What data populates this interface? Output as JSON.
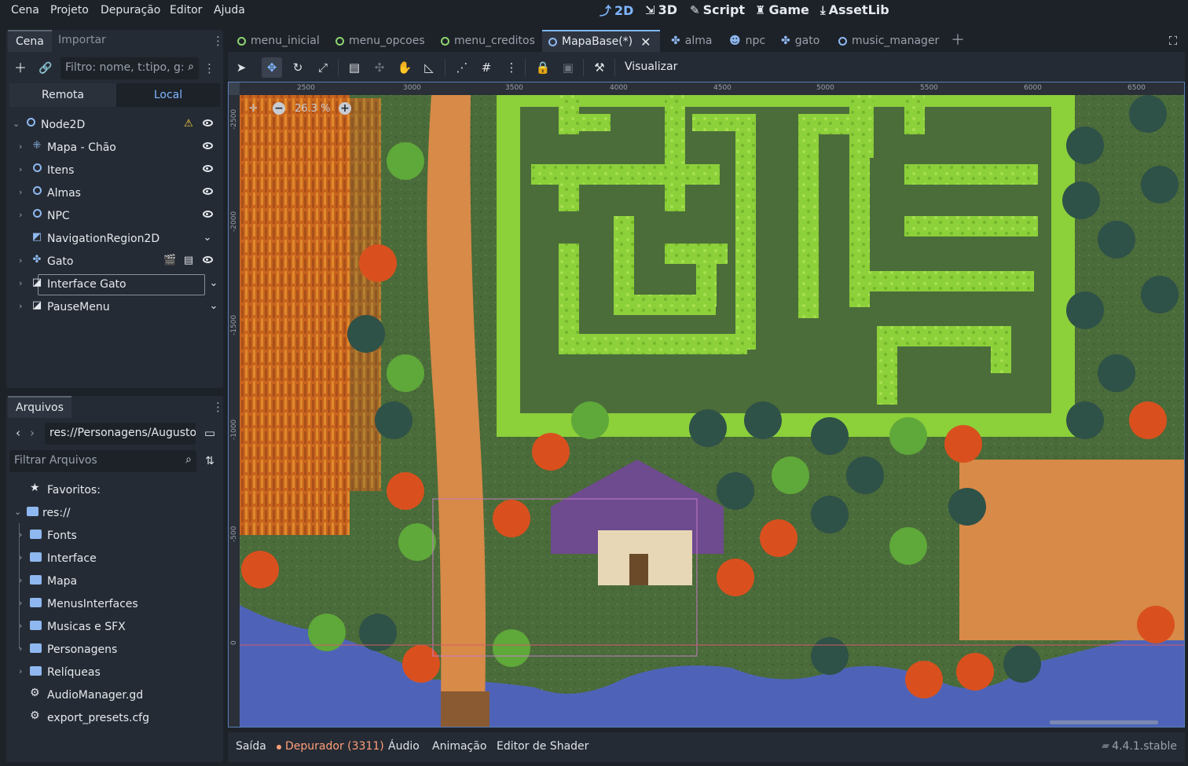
{
  "menu": [
    "Cena",
    "Projeto",
    "Depuração",
    "Editor",
    "Ajuda"
  ],
  "workspaces": [
    {
      "label": "2D",
      "icon": "2d-icon",
      "active": true
    },
    {
      "label": "3D",
      "icon": "3d-icon",
      "active": false
    },
    {
      "label": "Script",
      "icon": "script-icon",
      "active": false
    },
    {
      "label": "Game",
      "icon": "game-icon",
      "active": false
    },
    {
      "label": "AssetLib",
      "icon": "assetlib-icon",
      "active": false
    }
  ],
  "scene_dock": {
    "tabs": [
      "Cena",
      "Importar"
    ],
    "filter_placeholder": "Filtro: nome, t:tipo, g:",
    "remote_label": "Remota",
    "local_label": "Local",
    "nodes": [
      {
        "name": "Node2D",
        "icon": "node2d-icon"
      },
      {
        "name": "Mapa - Chão",
        "icon": "tilemap-icon"
      },
      {
        "name": "Itens",
        "icon": "node2d-icon"
      },
      {
        "name": "Almas",
        "icon": "node2d-icon"
      },
      {
        "name": "NPC",
        "icon": "node2d-icon"
      },
      {
        "name": "NavigationRegion2D",
        "icon": "navigation-icon"
      },
      {
        "name": "Gato",
        "icon": "character-icon"
      },
      {
        "name": "Interface Gato",
        "icon": "canvaslayer-icon"
      },
      {
        "name": "PauseMenu",
        "icon": "canvaslayer-icon"
      }
    ]
  },
  "file_dock": {
    "title": "Arquivos",
    "path": "res://Personagens/Augusto",
    "filter_placeholder": "Filtrar Arquivos",
    "favorites": "Favoritos:",
    "root": "res://",
    "items": [
      {
        "name": "Fonts",
        "type": "folder"
      },
      {
        "name": "Interface",
        "type": "folder"
      },
      {
        "name": "Mapa",
        "type": "folder"
      },
      {
        "name": "MenusInterfaces",
        "type": "folder"
      },
      {
        "name": "Musicas e SFX",
        "type": "folder"
      },
      {
        "name": "Personagens",
        "type": "folder"
      },
      {
        "name": "Relíqueas",
        "type": "folder"
      },
      {
        "name": "AudioManager.gd",
        "type": "script"
      },
      {
        "name": "export_presets.cfg",
        "type": "config"
      }
    ]
  },
  "editor_tabs": [
    {
      "label": "menu_inicial",
      "icon": "scene-green"
    },
    {
      "label": "menu_opcoes",
      "icon": "scene-green"
    },
    {
      "label": "menu_creditos",
      "icon": "scene-green"
    },
    {
      "label": "MapaBase(*)",
      "icon": "scene-blue",
      "active": true
    },
    {
      "label": "alma",
      "icon": "character"
    },
    {
      "label": "npc",
      "icon": "npc"
    },
    {
      "label": "gato",
      "icon": "character"
    },
    {
      "label": "music_manager",
      "icon": "scene-blue"
    }
  ],
  "toolbar": {
    "view_label": "Visualizar",
    "zoom": "26.3 %"
  },
  "rulers": {
    "top": [
      "2500",
      "3000",
      "3500",
      "4000",
      "4500",
      "5000",
      "5500",
      "6000",
      "6500"
    ],
    "left": [
      "-2500",
      "-2000",
      "-1500",
      "-1000",
      "-500",
      "0"
    ]
  },
  "bottom_panel": {
    "tabs": [
      "Saída",
      "Depurador (3311)",
      "Áudio",
      "Animação",
      "Editor de Shader"
    ],
    "version": "4.4.1.stable"
  },
  "colors": {
    "accent": "#7fb6ff",
    "background": "#1d2229",
    "panel": "#252b34",
    "warning": "#ff9f7a"
  }
}
